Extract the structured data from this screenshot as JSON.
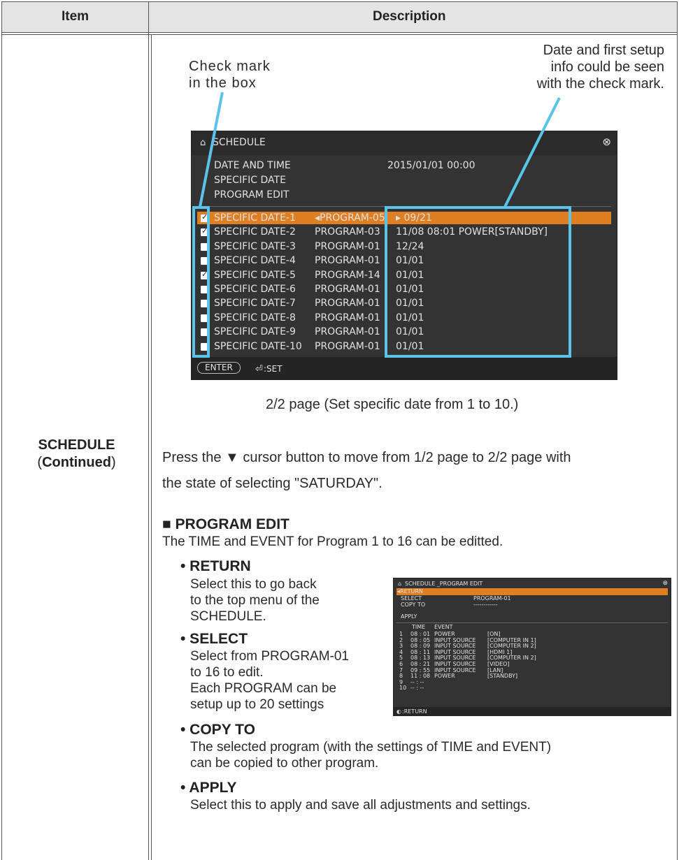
{
  "table": {
    "header_item": "Item",
    "header_description": "Description",
    "item_name": "SCHEDULE",
    "item_continued_open": "(",
    "item_continued": "Continued",
    "item_continued_close": ")"
  },
  "annotations": {
    "check_mark_line1": "Check mark",
    "check_mark_line2": "in the box",
    "date_info_line1": "Date and first setup",
    "date_info_line2": "info could be seen",
    "date_info_line3": "with the check mark."
  },
  "schedule_screen": {
    "title": "SCHEDULE",
    "menu": [
      "DATE AND TIME",
      "SPECIFIC DATE",
      "PROGRAM EDIT"
    ],
    "date_time_value": "2015/01/01 00:00",
    "rows": [
      {
        "name": "SPECIFIC DATE-1",
        "program": "◂PROGRAM-05",
        "info": "▸ 09/21",
        "checked": true,
        "selected": true
      },
      {
        "name": "SPECIFIC DATE-2",
        "program": "PROGRAM-03",
        "info": "11/08 08:01 POWER[STANDBY]",
        "checked": true,
        "selected": false
      },
      {
        "name": "SPECIFIC DATE-3",
        "program": "PROGRAM-01",
        "info": "12/24",
        "checked": false,
        "selected": false
      },
      {
        "name": "SPECIFIC DATE-4",
        "program": "PROGRAM-01",
        "info": "01/01",
        "checked": false,
        "selected": false
      },
      {
        "name": "SPECIFIC DATE-5",
        "program": "PROGRAM-14",
        "info": "01/01",
        "checked": true,
        "selected": false
      },
      {
        "name": "SPECIFIC DATE-6",
        "program": "PROGRAM-01",
        "info": "01/01",
        "checked": false,
        "selected": false
      },
      {
        "name": "SPECIFIC DATE-7",
        "program": "PROGRAM-01",
        "info": "01/01",
        "checked": false,
        "selected": false
      },
      {
        "name": "SPECIFIC DATE-8",
        "program": "PROGRAM-01",
        "info": "01/01",
        "checked": false,
        "selected": false
      },
      {
        "name": "SPECIFIC DATE-9",
        "program": "PROGRAM-01",
        "info": "01/01",
        "checked": false,
        "selected": false
      },
      {
        "name": "SPECIFIC DATE-10",
        "program": "PROGRAM-01",
        "info": "01/01",
        "checked": false,
        "selected": false
      }
    ],
    "footer_enter": "ENTER",
    "footer_set": ":SET",
    "highlight_color": "#e07f22"
  },
  "caption_page": "2/2 page (Set specific date from 1 to 10.)",
  "press_text_line1": "Press the ▼ cursor button to move from 1/2 page to 2/2 page with",
  "press_text_line2": "the state of selecting \"SATURDAY\".",
  "program_edit": {
    "heading": "■ PROGRAM EDIT",
    "intro": "The TIME and EVENT for Program 1 to 16 can be editted.",
    "return_title": "• RETURN",
    "return_desc": [
      "Select this to go back",
      "to the top menu of the",
      "SCHEDULE."
    ],
    "select_title": "• SELECT",
    "select_desc": [
      "Select from PROGRAM-01",
      "to 16 to edit.",
      "Each PROGRAM can be",
      "setup up to 20 settings"
    ],
    "copy_title": "• COPY TO",
    "copy_desc": [
      "The selected program (with the settings of TIME and EVENT)",
      "can be copied to other program."
    ],
    "apply_title": "• APPLY",
    "apply_desc": "Select this to apply and save all adjustments and settings."
  },
  "program_edit_screen": {
    "title": "SCHEDULE _PROGRAM EDIT",
    "return": "◂RETURN",
    "select_label": "SELECT",
    "select_value": "PROGRAM-01",
    "copy_label": "COPY TO",
    "copy_value": "------------",
    "apply_label": "APPLY",
    "col_time": "TIME",
    "col_event": "EVENT",
    "entries": [
      {
        "n": "1",
        "time": "08 : 01",
        "event": "POWER",
        "value": "[ON]"
      },
      {
        "n": "2",
        "time": "08 : 05",
        "event": "INPUT SOURCE",
        "value": "[COMPUTER IN 1]"
      },
      {
        "n": "3",
        "time": "08 : 09",
        "event": "INPUT SOURCE",
        "value": "[COMPUTER IN 2]"
      },
      {
        "n": "4",
        "time": "08 : 11",
        "event": "INPUT SOURCE",
        "value": "[HDMI 1]"
      },
      {
        "n": "5",
        "time": "08 : 13",
        "event": "INPUT SOURCE",
        "value": "[COMPUTER IN 2]"
      },
      {
        "n": "6",
        "time": "08 : 21",
        "event": "INPUT SOURCE",
        "value": "[VIDEO]"
      },
      {
        "n": "7",
        "time": "09 : 55",
        "event": "INPUT SOURCE",
        "value": "[LAN]"
      },
      {
        "n": "8",
        "time": "11 : 08",
        "event": "POWER",
        "value": "[STANDBY]"
      },
      {
        "n": "9",
        "time": "-- : --",
        "event": "",
        "value": ""
      },
      {
        "n": "10",
        "time": "-- : --",
        "event": "",
        "value": ""
      }
    ],
    "footer": ":RETURN"
  }
}
